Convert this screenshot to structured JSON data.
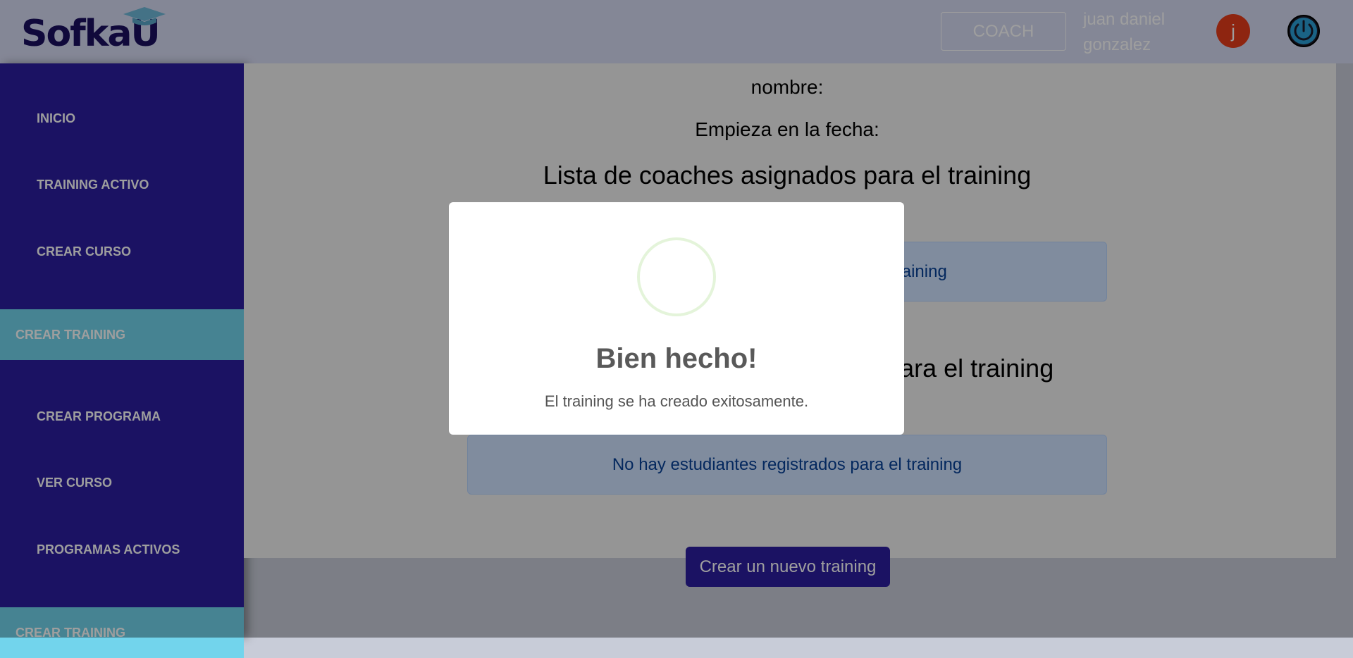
{
  "header": {
    "logo_text": "SofkaU",
    "role_button": "COACH",
    "user_name": "juan daniel gonzalez",
    "avatar_letter": "j"
  },
  "sidebar": {
    "items": [
      {
        "label": "INICIO"
      },
      {
        "label": "TRAINING ACTIVO"
      },
      {
        "label": "CREAR CURSO"
      },
      {
        "label": "CREAR TRAINING"
      },
      {
        "label": "CREAR PROGRAMA"
      },
      {
        "label": "VER CURSO"
      },
      {
        "label": "PROGRAMAS ACTIVOS"
      },
      {
        "label": "CREAR TRAINING"
      }
    ]
  },
  "main": {
    "nombre_label": "nombre:",
    "fecha_label": "Empieza en la fecha:",
    "coaches_title": "Lista de coaches asignados para el training",
    "coaches_alert": "No hay coaches asignados para el training",
    "students_title": "Lista de estudiantes registrados para el training",
    "students_alert": "No hay estudiantes registrados para el training",
    "create_button": "Crear un nuevo training"
  },
  "modal": {
    "icon": "success-icon",
    "title": "Bien hecho!",
    "text": "El training se ha creado exitosamente."
  },
  "colors": {
    "sidebar": "#2c1ea0",
    "active_item": "#72d4ec",
    "header": "#d6daf2",
    "avatar": "#e63c1a"
  }
}
